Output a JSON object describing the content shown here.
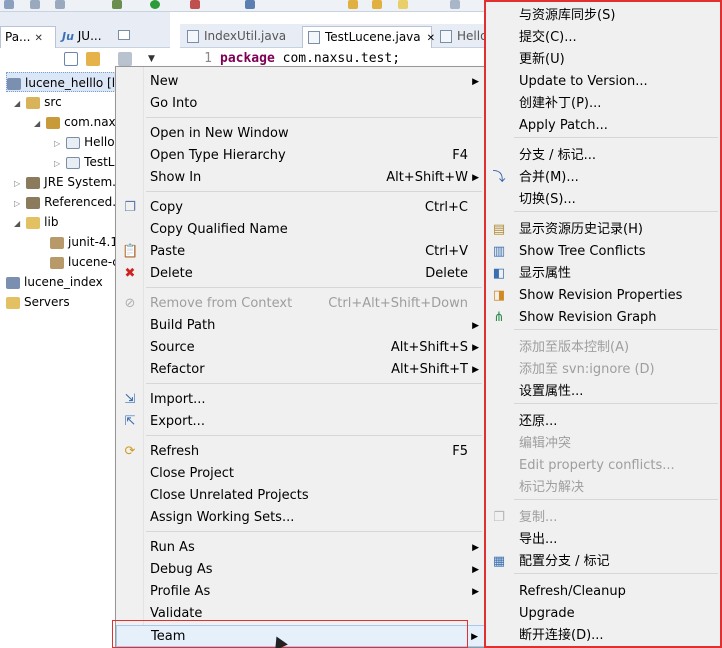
{
  "left_tabs": [
    {
      "label": "Pa...",
      "close": "✕"
    },
    {
      "label": "JU...",
      "close": ""
    }
  ],
  "tree": [
    {
      "label": "lucene_helllo [l..."
    },
    {
      "label": "src"
    },
    {
      "label": "com.nax..."
    },
    {
      "label": "Hello..."
    },
    {
      "label": "TestL..."
    },
    {
      "label": "JRE System..."
    },
    {
      "label": "Referenced..."
    },
    {
      "label": "lib"
    },
    {
      "label": "junit-4.1..."
    },
    {
      "label": "lucene-c..."
    },
    {
      "label": "lucene_index"
    },
    {
      "label": "Servers"
    }
  ],
  "editor": {
    "tabs": [
      {
        "label": "IndexUtil.java"
      },
      {
        "label": "TestLucene.java",
        "close": "✕"
      },
      {
        "label": "Hello..."
      }
    ],
    "line_number": "1",
    "keyword": "package",
    "code": "com.naxsu.test;"
  },
  "menu": {
    "items": [
      {
        "label": "New",
        "shortcut": "",
        "submenu": true,
        "disabled": false,
        "icon": ""
      },
      {
        "label": "Go Into",
        "shortcut": "",
        "submenu": false,
        "disabled": false,
        "icon": ""
      },
      {
        "label": "Open in New Window",
        "shortcut": "",
        "submenu": false,
        "disabled": false,
        "icon": ""
      },
      {
        "label": "Open Type Hierarchy",
        "shortcut": "F4",
        "submenu": false,
        "disabled": false,
        "icon": ""
      },
      {
        "label": "Show In",
        "shortcut": "Alt+Shift+W",
        "submenu": true,
        "disabled": false,
        "icon": ""
      },
      {
        "label": "Copy",
        "shortcut": "Ctrl+C",
        "submenu": false,
        "disabled": false,
        "icon": "copy-icon"
      },
      {
        "label": "Copy Qualified Name",
        "shortcut": "",
        "submenu": false,
        "disabled": false,
        "icon": ""
      },
      {
        "label": "Paste",
        "shortcut": "Ctrl+V",
        "submenu": false,
        "disabled": false,
        "icon": "paste-icon"
      },
      {
        "label": "Delete",
        "shortcut": "Delete",
        "submenu": false,
        "disabled": false,
        "icon": "delete-icon"
      },
      {
        "label": "Remove from Context",
        "shortcut": "Ctrl+Alt+Shift+Down",
        "submenu": false,
        "disabled": true,
        "icon": "remove-context-icon"
      },
      {
        "label": "Build Path",
        "shortcut": "",
        "submenu": true,
        "disabled": false,
        "icon": ""
      },
      {
        "label": "Source",
        "shortcut": "Alt+Shift+S",
        "submenu": true,
        "disabled": false,
        "icon": ""
      },
      {
        "label": "Refactor",
        "shortcut": "Alt+Shift+T",
        "submenu": true,
        "disabled": false,
        "icon": ""
      },
      {
        "label": "Import...",
        "shortcut": "",
        "submenu": false,
        "disabled": false,
        "icon": "import-icon"
      },
      {
        "label": "Export...",
        "shortcut": "",
        "submenu": false,
        "disabled": false,
        "icon": "export-icon"
      },
      {
        "label": "Refresh",
        "shortcut": "F5",
        "submenu": false,
        "disabled": false,
        "icon": "refresh-icon"
      },
      {
        "label": "Close Project",
        "shortcut": "",
        "submenu": false,
        "disabled": false,
        "icon": ""
      },
      {
        "label": "Close Unrelated Projects",
        "shortcut": "",
        "submenu": false,
        "disabled": false,
        "icon": ""
      },
      {
        "label": "Assign Working Sets...",
        "shortcut": "",
        "submenu": false,
        "disabled": false,
        "icon": ""
      },
      {
        "label": "Run As",
        "shortcut": "",
        "submenu": true,
        "disabled": false,
        "icon": ""
      },
      {
        "label": "Debug As",
        "shortcut": "",
        "submenu": true,
        "disabled": false,
        "icon": ""
      },
      {
        "label": "Profile As",
        "shortcut": "",
        "submenu": true,
        "disabled": false,
        "icon": ""
      },
      {
        "label": "Validate",
        "shortcut": "",
        "submenu": false,
        "disabled": false,
        "icon": ""
      },
      {
        "label": "Team",
        "shortcut": "",
        "submenu": true,
        "disabled": false,
        "icon": "",
        "highlighted": true
      }
    ]
  },
  "team_submenu": {
    "items": [
      {
        "label": "与资源库同步(S)",
        "disabled": false,
        "icon": ""
      },
      {
        "label": "提交(C)...",
        "disabled": false,
        "icon": ""
      },
      {
        "label": "更新(U)",
        "disabled": false,
        "icon": ""
      },
      {
        "label": "Update to Version...",
        "disabled": false,
        "icon": ""
      },
      {
        "label": "创建补丁(P)...",
        "disabled": false,
        "icon": ""
      },
      {
        "label": "Apply Patch...",
        "disabled": false,
        "icon": ""
      },
      {
        "label": "分支 / 标记...",
        "disabled": false,
        "icon": ""
      },
      {
        "label": "合并(M)...",
        "disabled": false,
        "icon": "merge-icon"
      },
      {
        "label": "切换(S)...",
        "disabled": false,
        "icon": ""
      },
      {
        "label": "显示资源历史记录(H)",
        "disabled": false,
        "icon": "history-icon"
      },
      {
        "label": "Show Tree Conflicts",
        "disabled": false,
        "icon": "tree-conflicts-icon"
      },
      {
        "label": "显示属性",
        "disabled": false,
        "icon": "properties-icon"
      },
      {
        "label": "Show Revision Properties",
        "disabled": false,
        "icon": "revision-properties-icon"
      },
      {
        "label": "Show Revision Graph",
        "disabled": false,
        "icon": "revision-graph-icon"
      },
      {
        "label": "添加至版本控制(A)",
        "disabled": true,
        "icon": ""
      },
      {
        "label": "添加至 svn:ignore (D)",
        "disabled": true,
        "icon": ""
      },
      {
        "label": "设置属性...",
        "disabled": false,
        "icon": ""
      },
      {
        "label": "还原...",
        "disabled": false,
        "icon": ""
      },
      {
        "label": "编辑冲突",
        "disabled": true,
        "icon": ""
      },
      {
        "label": "Edit property conflicts...",
        "disabled": true,
        "icon": ""
      },
      {
        "label": "标记为解决",
        "disabled": true,
        "icon": ""
      },
      {
        "label": "复制...",
        "disabled": true,
        "icon": "copy-icon"
      },
      {
        "label": "导出...",
        "disabled": false,
        "icon": ""
      },
      {
        "label": "配置分支 / 标记",
        "disabled": false,
        "icon": "configure-branches-icon"
      },
      {
        "label": "Refresh/Cleanup",
        "disabled": false,
        "icon": ""
      },
      {
        "label": "Upgrade",
        "disabled": false,
        "icon": ""
      },
      {
        "label": "断开连接(D)...",
        "disabled": false,
        "icon": ""
      }
    ]
  },
  "colors": {
    "highlight_border": "#e03030",
    "menu_bg": "#f0f0f0",
    "disabled_text": "#9e9e9e",
    "keyword": "#7f0055"
  }
}
